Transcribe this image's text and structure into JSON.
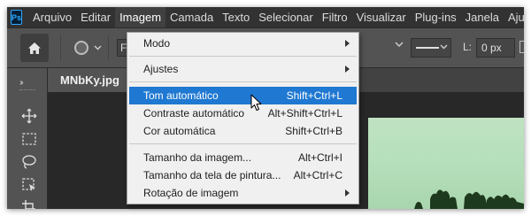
{
  "app": {
    "logo_text": "Ps",
    "menubar": [
      "Arquivo",
      "Editar",
      "Imagem",
      "Camada",
      "Texto",
      "Selecionar",
      "Filtro",
      "Visualizar",
      "Plug-ins",
      "Janela",
      "Ajuda"
    ],
    "active_menu": "Imagem"
  },
  "options_bar": {
    "first_field_value": "F",
    "stroke_width_label": "L:",
    "stroke_width_value": "0 px"
  },
  "document": {
    "tab_title": "MNbKy.jpg"
  },
  "image_menu": {
    "items": [
      {
        "label": "Modo",
        "shortcut": "",
        "submenu": true
      },
      {
        "label": "Ajustes",
        "shortcut": "",
        "submenu": true
      },
      {
        "label": "Tom automático",
        "shortcut": "Shift+Ctrl+L",
        "submenu": false,
        "highlighted": true
      },
      {
        "label": "Contraste automático",
        "shortcut": "Alt+Shift+Ctrl+L",
        "submenu": false
      },
      {
        "label": "Cor automática",
        "shortcut": "Shift+Ctrl+B",
        "submenu": false
      },
      {
        "label": "Tamanho da imagem...",
        "shortcut": "Alt+Ctrl+I",
        "submenu": false
      },
      {
        "label": "Tamanho da tela de pintura...",
        "shortcut": "Alt+Ctrl+C",
        "submenu": false
      },
      {
        "label": "Rotação de imagem",
        "shortcut": "",
        "submenu": true
      }
    ]
  },
  "colors": {
    "menubar_bg": "#323232",
    "panel_bg": "#535353",
    "menu_bg": "#f0f0f0",
    "highlight": "#1f78d1",
    "image_sky": "#b4deb9"
  },
  "icons": [
    "ps-logo",
    "home-icon",
    "ellipse-tool-icon",
    "move-tool-icon",
    "marquee-tool-icon",
    "lasso-tool-icon",
    "object-select-icon",
    "crop-tool-icon",
    "pointer-cursor-icon",
    "submenu-arrow-icon"
  ]
}
